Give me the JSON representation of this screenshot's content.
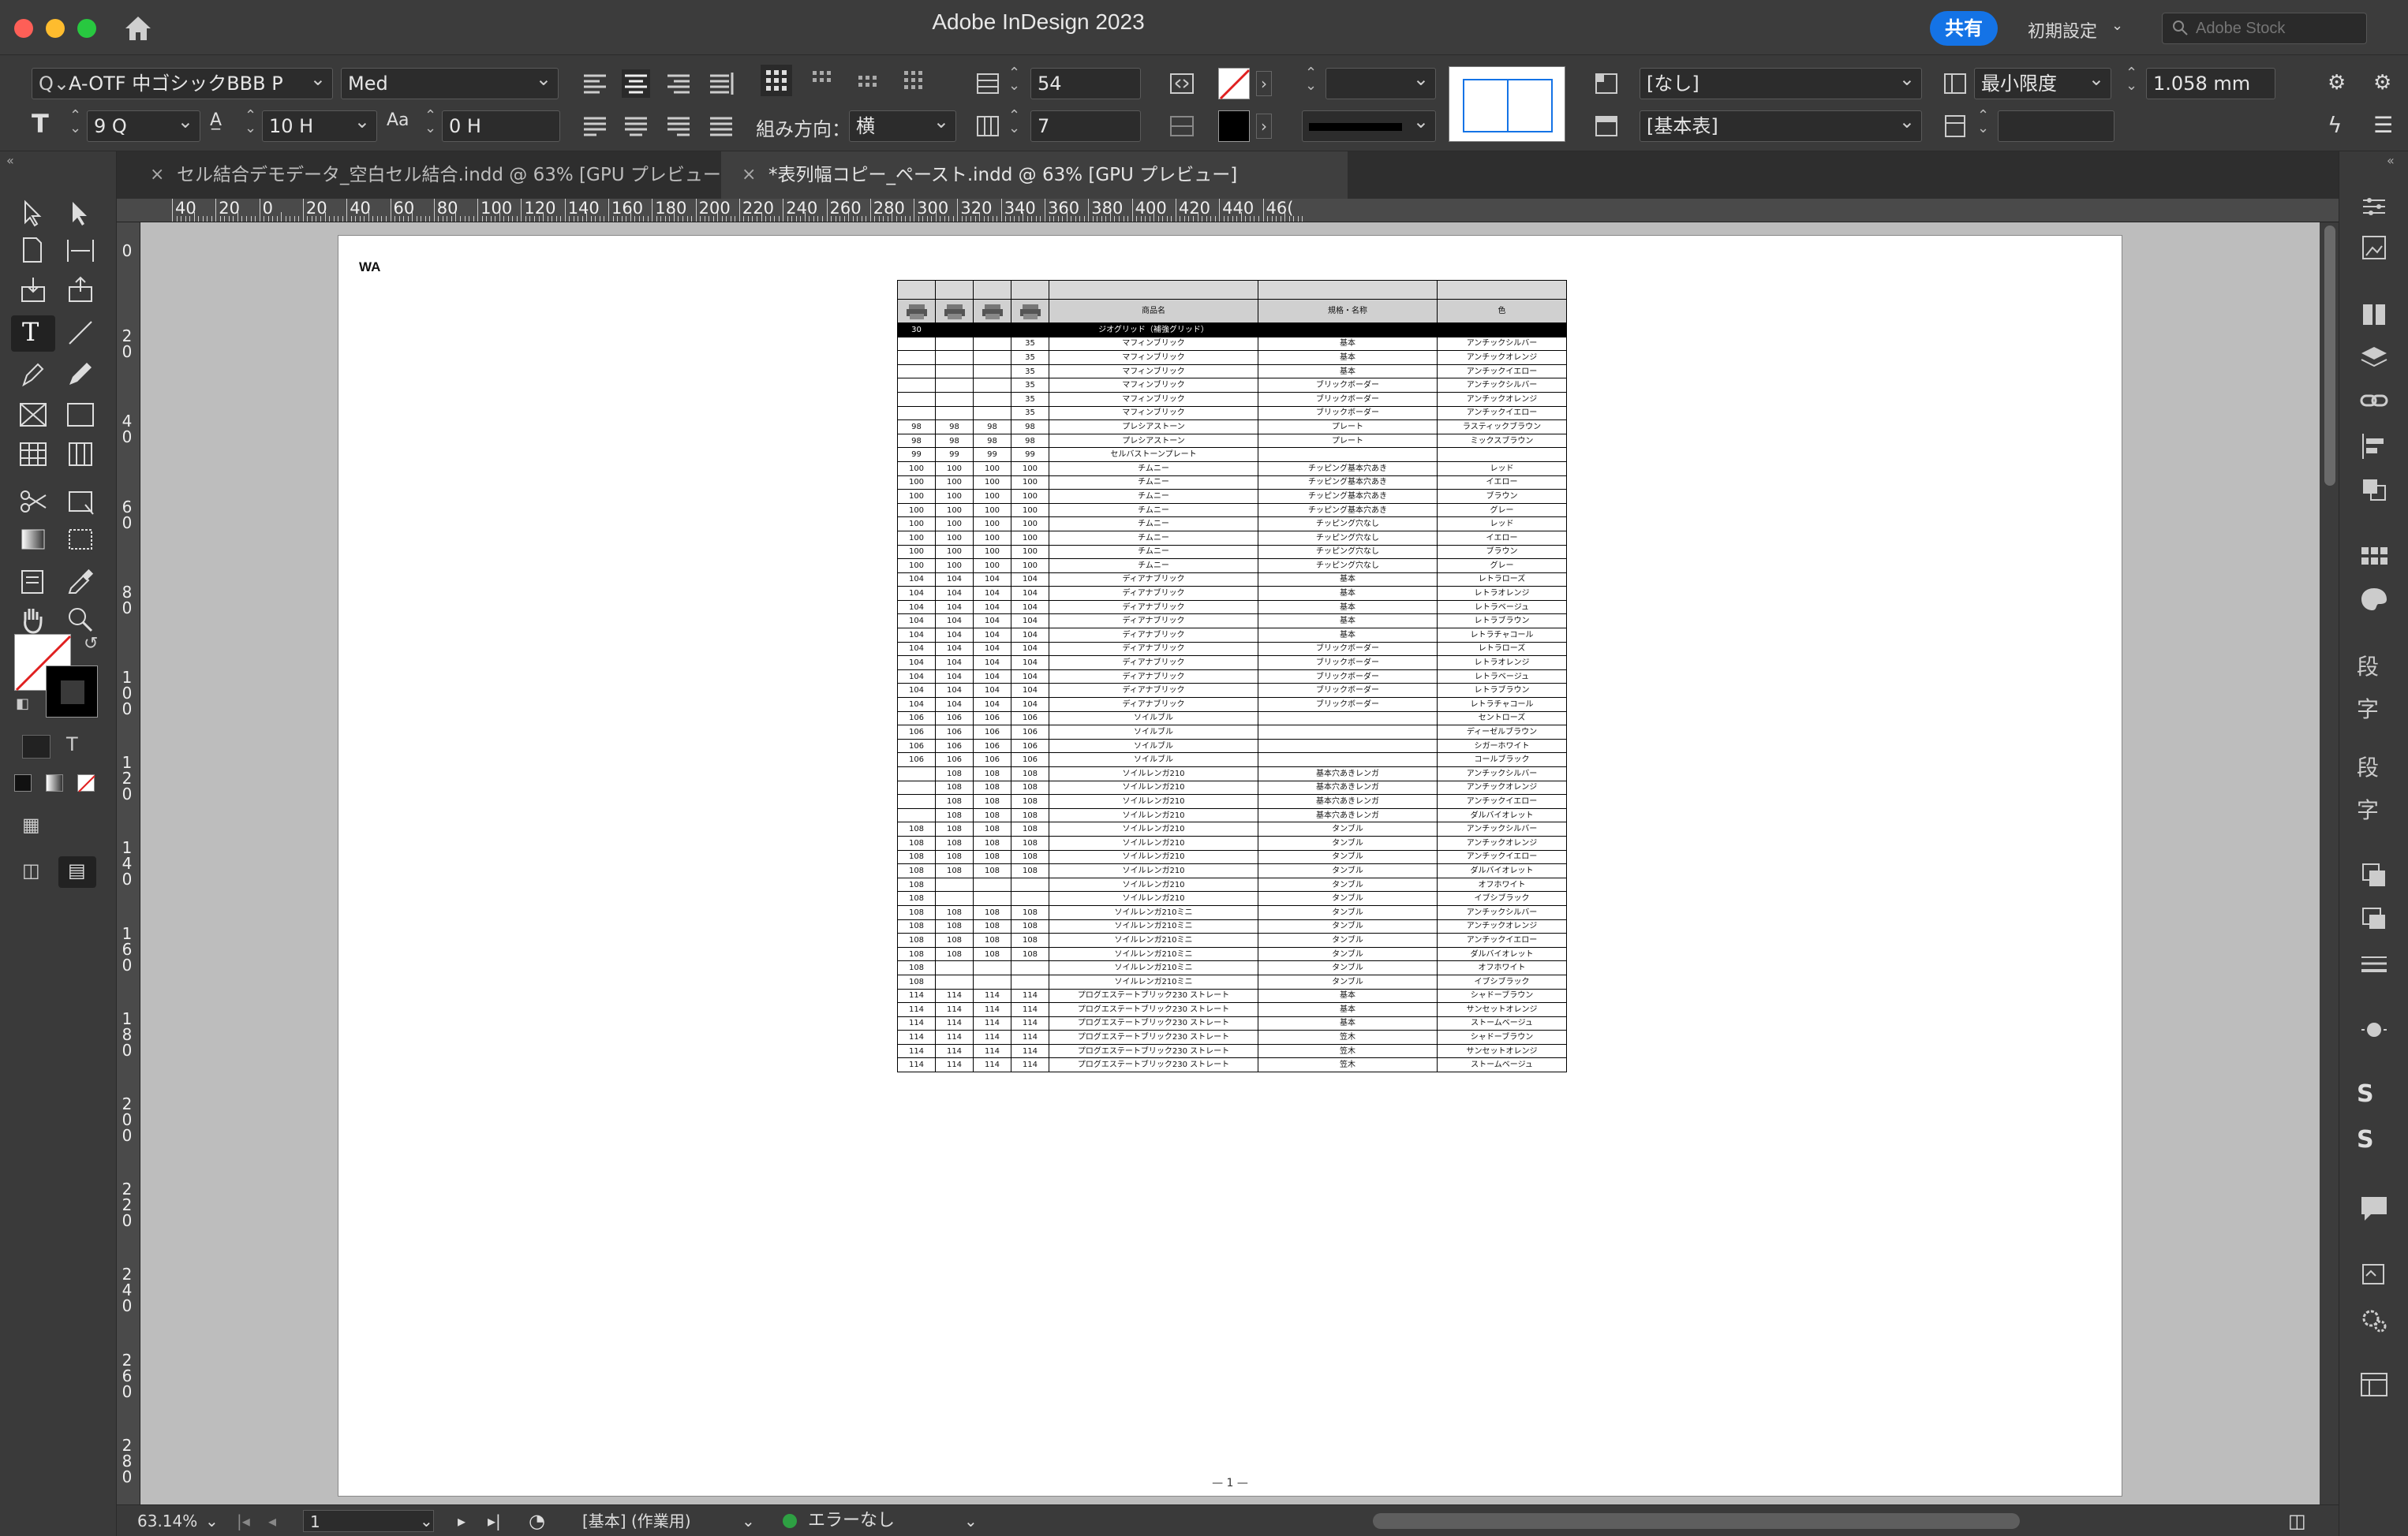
{
  "window": {
    "title": "Adobe InDesign 2023",
    "share_label": "共有",
    "workspace_label": "初期設定",
    "stock_placeholder": "Adobe Stock"
  },
  "control_panel": {
    "font_family": "A-OTF 中ゴシックBBB P",
    "font_style": "Med",
    "font_size": "9 Q",
    "leading": "10 H",
    "tracking": "0 H",
    "composition_label": "組み方向：",
    "composition_value": "横",
    "rows_value": "54",
    "columns_value": "7",
    "cell_style": "[なし]",
    "table_style": "[基本表]",
    "row_height_mode": "最小限度",
    "row_height_value": "1.058 mm",
    "column_width_value": ""
  },
  "tabs": [
    {
      "label": "セル結合デモデータ_空白セル結合.indd @ 63% [GPU プレビュー]",
      "active": false
    },
    {
      "label": "*表列幅コピー_ペースト.indd @ 63% [GPU プレビュー]",
      "active": true
    }
  ],
  "ruler": {
    "h_labels": [
      "40",
      "20",
      "0",
      "20",
      "40",
      "60",
      "80",
      "100",
      "120",
      "140",
      "160",
      "180",
      "200",
      "220",
      "240",
      "260",
      "280",
      "300",
      "320",
      "340",
      "360",
      "380",
      "400",
      "420",
      "440",
      "46("
    ],
    "v_labels": [
      "0",
      "20",
      "40",
      "60",
      "80",
      "100",
      "120",
      "140",
      "160",
      "180",
      "200",
      "220",
      "240",
      "260",
      "280"
    ]
  },
  "page": {
    "header_text": "WA",
    "page_number": "— 1 —"
  },
  "table": {
    "header_row": [
      "",
      "",
      "",
      "",
      "商品名",
      "規格・名称",
      "色"
    ],
    "rows": [
      [
        "30",
        "",
        "",
        "",
        "ジオグリッド（補強グリッド）",
        "",
        ""
      ],
      [
        "",
        "",
        "",
        "35",
        "マフィンブリック",
        "基本",
        "アンチックシルバー"
      ],
      [
        "",
        "",
        "",
        "35",
        "マフィンブリック",
        "基本",
        "アンチックオレンジ"
      ],
      [
        "",
        "",
        "",
        "35",
        "マフィンブリック",
        "基本",
        "アンチックイエロー"
      ],
      [
        "",
        "",
        "",
        "35",
        "マフィンブリック",
        "ブリックボーダー",
        "アンチックシルバー"
      ],
      [
        "",
        "",
        "",
        "35",
        "マフィンブリック",
        "ブリックボーダー",
        "アンチックオレンジ"
      ],
      [
        "",
        "",
        "",
        "35",
        "マフィンブリック",
        "ブリックボーダー",
        "アンチックイエロー"
      ],
      [
        "98",
        "98",
        "98",
        "98",
        "プレシアストーン",
        "プレート",
        "ラスティックブラウン"
      ],
      [
        "98",
        "98",
        "98",
        "98",
        "プレシアストーン",
        "プレート",
        "ミックスブラウン"
      ],
      [
        "99",
        "99",
        "99",
        "99",
        "セルバストーンプレート",
        "",
        ""
      ],
      [
        "100",
        "100",
        "100",
        "100",
        "チムニー",
        "チッピング基本穴あき",
        "レッド"
      ],
      [
        "100",
        "100",
        "100",
        "100",
        "チムニー",
        "チッピング基本穴あき",
        "イエロー"
      ],
      [
        "100",
        "100",
        "100",
        "100",
        "チムニー",
        "チッピング基本穴あき",
        "ブラウン"
      ],
      [
        "100",
        "100",
        "100",
        "100",
        "チムニー",
        "チッピング基本穴あき",
        "グレー"
      ],
      [
        "100",
        "100",
        "100",
        "100",
        "チムニー",
        "チッピング穴なし",
        "レッド"
      ],
      [
        "100",
        "100",
        "100",
        "100",
        "チムニー",
        "チッピング穴なし",
        "イエロー"
      ],
      [
        "100",
        "100",
        "100",
        "100",
        "チムニー",
        "チッピング穴なし",
        "ブラウン"
      ],
      [
        "100",
        "100",
        "100",
        "100",
        "チムニー",
        "チッピング穴なし",
        "グレー"
      ],
      [
        "104",
        "104",
        "104",
        "104",
        "ディアナブリック",
        "基本",
        "レトラローズ"
      ],
      [
        "104",
        "104",
        "104",
        "104",
        "ディアナブリック",
        "基本",
        "レトラオレンジ"
      ],
      [
        "104",
        "104",
        "104",
        "104",
        "ディアナブリック",
        "基本",
        "レトラベージュ"
      ],
      [
        "104",
        "104",
        "104",
        "104",
        "ディアナブリック",
        "基本",
        "レトラブラウン"
      ],
      [
        "104",
        "104",
        "104",
        "104",
        "ディアナブリック",
        "基本",
        "レトラチャコール"
      ],
      [
        "104",
        "104",
        "104",
        "104",
        "ディアナブリック",
        "ブリックボーダー",
        "レトラローズ"
      ],
      [
        "104",
        "104",
        "104",
        "104",
        "ディアナブリック",
        "ブリックボーダー",
        "レトラオレンジ"
      ],
      [
        "104",
        "104",
        "104",
        "104",
        "ディアナブリック",
        "ブリックボーダー",
        "レトラベージュ"
      ],
      [
        "104",
        "104",
        "104",
        "104",
        "ディアナブリック",
        "ブリックボーダー",
        "レトラブラウン"
      ],
      [
        "104",
        "104",
        "104",
        "104",
        "ディアナブリック",
        "ブリックボーダー",
        "レトラチャコール"
      ],
      [
        "106",
        "106",
        "106",
        "106",
        "ソイルブル",
        "",
        "セントローズ"
      ],
      [
        "106",
        "106",
        "106",
        "106",
        "ソイルブル",
        "",
        "ディーゼルブラウン"
      ],
      [
        "106",
        "106",
        "106",
        "106",
        "ソイルブル",
        "",
        "シガーホワイト"
      ],
      [
        "106",
        "106",
        "106",
        "106",
        "ソイルブル",
        "",
        "コールブラック"
      ],
      [
        "",
        "108",
        "108",
        "108",
        "ソイルレンガ210",
        "基本穴あきレンガ",
        "アンチックシルバー"
      ],
      [
        "",
        "108",
        "108",
        "108",
        "ソイルレンガ210",
        "基本穴あきレンガ",
        "アンチックオレンジ"
      ],
      [
        "",
        "108",
        "108",
        "108",
        "ソイルレンガ210",
        "基本穴あきレンガ",
        "アンチックイエロー"
      ],
      [
        "",
        "108",
        "108",
        "108",
        "ソイルレンガ210",
        "基本穴あきレンガ",
        "ダルバイオレット"
      ],
      [
        "108",
        "108",
        "108",
        "108",
        "ソイルレンガ210",
        "タンブル",
        "アンチックシルバー"
      ],
      [
        "108",
        "108",
        "108",
        "108",
        "ソイルレンガ210",
        "タンブル",
        "アンチックオレンジ"
      ],
      [
        "108",
        "108",
        "108",
        "108",
        "ソイルレンガ210",
        "タンブル",
        "アンチックイエロー"
      ],
      [
        "108",
        "108",
        "108",
        "108",
        "ソイルレンガ210",
        "タンブル",
        "ダルバイオレット"
      ],
      [
        "108",
        "",
        "",
        "",
        "ソイルレンガ210",
        "タンブル",
        "オフホワイト"
      ],
      [
        "108",
        "",
        "",
        "",
        "ソイルレンガ210",
        "タンブル",
        "イブシブラック"
      ],
      [
        "108",
        "108",
        "108",
        "108",
        "ソイルレンガ210ミニ",
        "タンブル",
        "アンチックシルバー"
      ],
      [
        "108",
        "108",
        "108",
        "108",
        "ソイルレンガ210ミニ",
        "タンブル",
        "アンチックオレンジ"
      ],
      [
        "108",
        "108",
        "108",
        "108",
        "ソイルレンガ210ミニ",
        "タンブル",
        "アンチックイエロー"
      ],
      [
        "108",
        "108",
        "108",
        "108",
        "ソイルレンガ210ミニ",
        "タンブル",
        "ダルバイオレット"
      ],
      [
        "108",
        "",
        "",
        "",
        "ソイルレンガ210ミニ",
        "タンブル",
        "オフホワイト"
      ],
      [
        "108",
        "",
        "",
        "",
        "ソイルレンガ210ミニ",
        "タンブル",
        "イブシブラック"
      ],
      [
        "114",
        "114",
        "114",
        "114",
        "プログエステートブリック230 ストレート",
        "基本",
        "シャドーブラウン"
      ],
      [
        "114",
        "114",
        "114",
        "114",
        "プログエステートブリック230 ストレート",
        "基本",
        "サンセットオレンジ"
      ],
      [
        "114",
        "114",
        "114",
        "114",
        "プログエステートブリック230 ストレート",
        "基本",
        "ストームベージュ"
      ],
      [
        "114",
        "114",
        "114",
        "114",
        "プログエステートブリック230 ストレート",
        "笠木",
        "シャドーブラウン"
      ],
      [
        "114",
        "114",
        "114",
        "114",
        "プログエステートブリック230 ストレート",
        "笠木",
        "サンセットオレンジ"
      ],
      [
        "114",
        "114",
        "114",
        "114",
        "プログエステートブリック230 ストレート",
        "笠木",
        "ストームベージュ"
      ]
    ]
  },
  "status": {
    "zoom": "63.14%",
    "page_field": "1",
    "style_label": "[基本] (作業用)",
    "errors": "エラーなし"
  },
  "colors": {
    "accent": "#1473e6",
    "ok": "#2ea043"
  }
}
